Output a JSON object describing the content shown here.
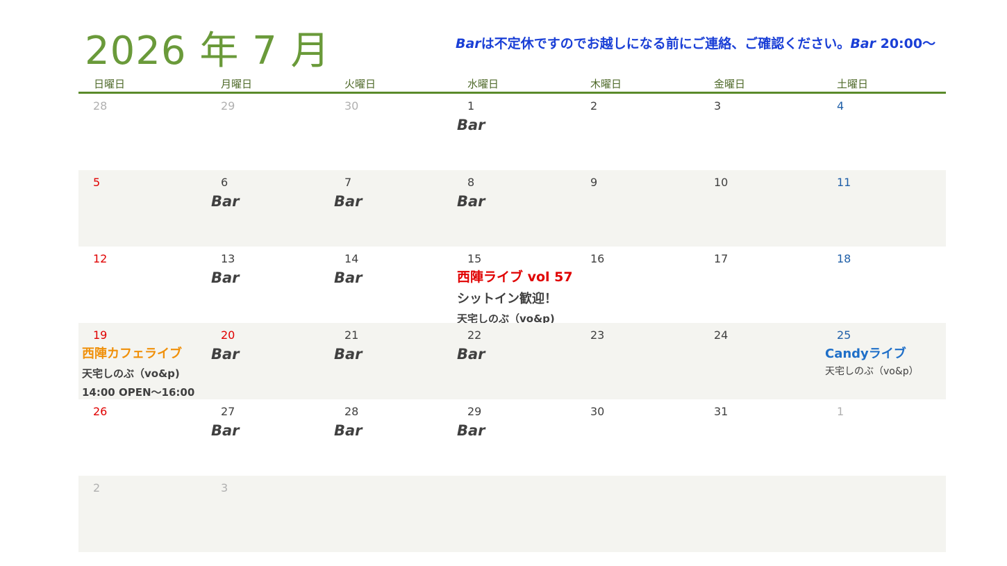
{
  "header": {
    "title": "2026 年 7 月",
    "notice_prefix": "Bar",
    "notice_middle": "は不定休ですのでお越しになる前にご連絡、ご確認ください。",
    "notice_bar": "Bar",
    "notice_time": " 20:00～"
  },
  "weekdays": [
    "日曜日",
    "月曜日",
    "火曜日",
    "水曜日",
    "木曜日",
    "金曜日",
    "土曜日"
  ],
  "weeks": [
    [
      "28",
      "29",
      "30",
      "1",
      "2",
      "3",
      "4"
    ],
    [
      "5",
      "6",
      "7",
      "8",
      "9",
      "10",
      "11"
    ],
    [
      "12",
      "13",
      "14",
      "15",
      "16",
      "17",
      "18"
    ],
    [
      "19",
      "20",
      "21",
      "22",
      "23",
      "24",
      "25"
    ],
    [
      "26",
      "27",
      "28",
      "29",
      "30",
      "31",
      "1"
    ],
    [
      "2",
      "3",
      "",
      "",
      "",
      "",
      ""
    ]
  ],
  "bar_label": "Bar",
  "events": {
    "live15_title": "西陣ライブ vol 57",
    "live15_sub": "シットイン歓迎！",
    "live15_artist": "天宅しのぶ（vo&p)",
    "cafe19_title": "西陣カフェライブ",
    "cafe19_artist": "天宅しのぶ（vo&p)",
    "cafe19_time": "14:00 OPEN～16:00",
    "candy25_title": "Candyライブ",
    "candy25_artist": "天宅しのぶ（vo&p）"
  },
  "colors": {
    "title": "#6a9a3a",
    "notice": "#1a3fd6",
    "sunday": "#e00000",
    "saturday": "#1f5fa8",
    "other_month": "#b0b0b0",
    "event_red": "#e00000",
    "event_orange": "#f0900a",
    "event_blue": "#1f6fc8"
  }
}
